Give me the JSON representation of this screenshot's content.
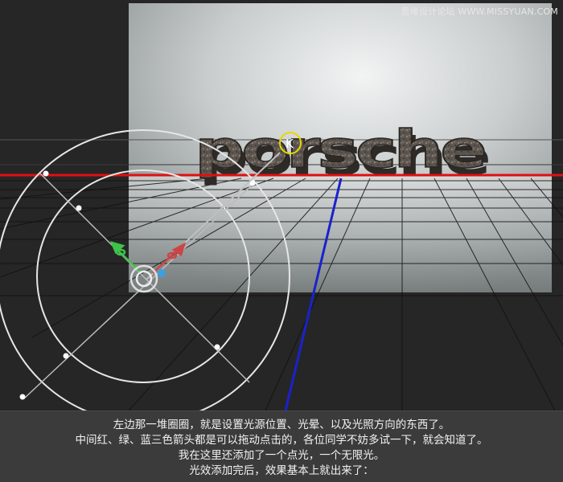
{
  "watermark": "思缘设计论坛 WWW.MISSYUAN.COM",
  "scene": {
    "logo_text": "porsche",
    "light_icon_letter": "K"
  },
  "caption": {
    "lines": [
      "左边那一堆圈圈，就是设置光源位置、光晕、以及光照方向的东西了。",
      "中间红、绿、蓝三色箭头都是可以拖动点击的，各位同学不妨多试一下，就会知道了。",
      "我在这里还添加了一个点光，一个无限光。",
      "光效添加完后，效果基本上就出来了："
    ]
  },
  "colors": {
    "x_axis": "#e01010",
    "z_axis": "#1a22cc",
    "gizmo_green": "#3fc24a",
    "gizmo_red": "#cc4444",
    "gizmo_blue": "#3aa0e0",
    "light_icon": "#e8d800"
  }
}
